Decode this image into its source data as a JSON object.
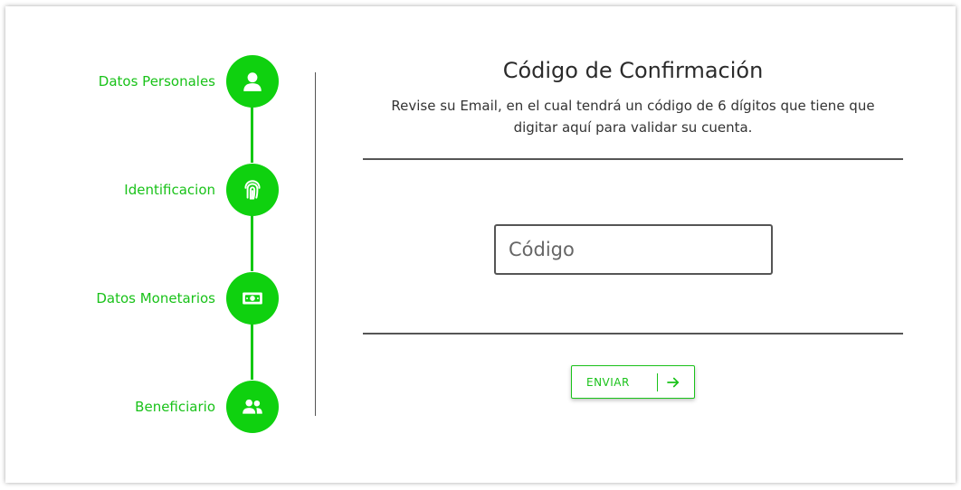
{
  "stepper": {
    "steps": [
      {
        "label": "Datos Personales",
        "icon": "user-icon"
      },
      {
        "label": "Identificacion",
        "icon": "fingerprint-icon"
      },
      {
        "label": "Datos Monetarios",
        "icon": "money-bill-icon"
      },
      {
        "label": "Beneficiario",
        "icon": "users-icon"
      }
    ]
  },
  "main": {
    "title": "Código de Confirmación",
    "subtitle": "Revise su Email, en el cual tendrá un código de 6 dígitos que tiene que digitar aquí para validar su cuenta.",
    "code_input": {
      "value": "",
      "placeholder": "Código"
    },
    "send_button": {
      "label": "ENVIAR",
      "icon": "arrow-right-icon"
    }
  },
  "colors": {
    "accent": "#0fd10f",
    "accent_text": "#19c219",
    "text_dark": "#2b2b2b",
    "divider": "#555555"
  }
}
